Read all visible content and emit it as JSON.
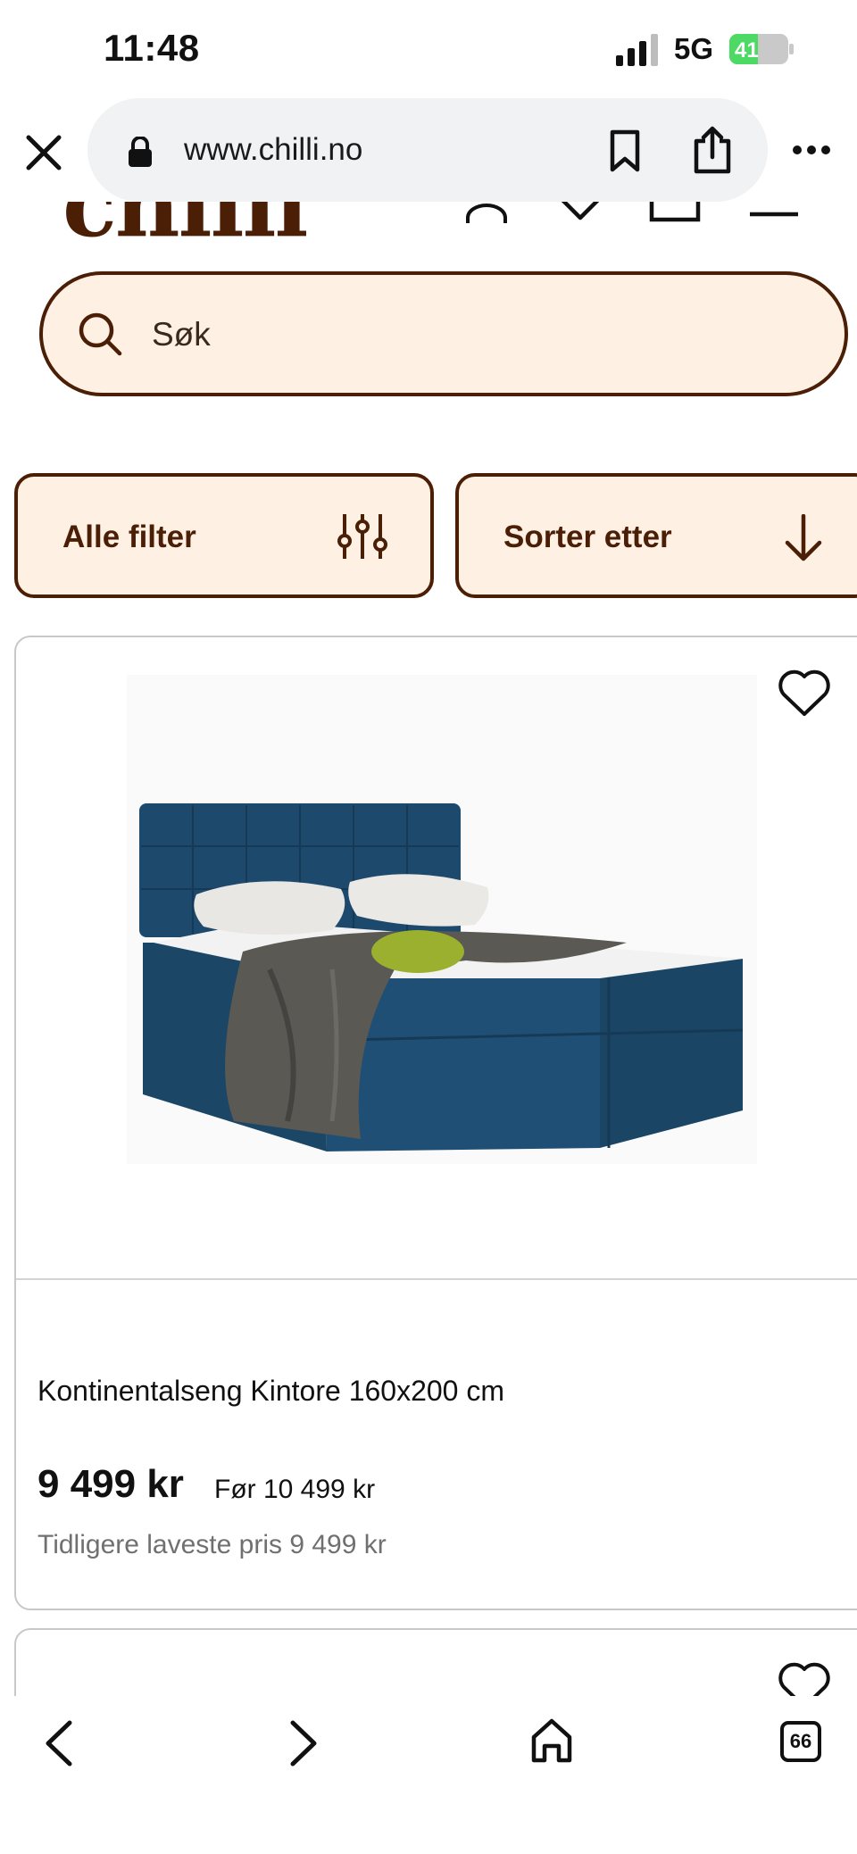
{
  "status_bar": {
    "time": "11:48",
    "network": "5G",
    "battery": "41"
  },
  "browser": {
    "url": "www.chilli.no",
    "tab_count": "66"
  },
  "site": {
    "logo": "chilli",
    "search_placeholder": "Søk",
    "filters": {
      "all_filters_label": "Alle filter",
      "sort_label": "Sorter etter"
    }
  },
  "product": {
    "title": "Kontinentalseng Kintore 160x200 cm",
    "price": "9 499 kr",
    "old_price": "Før 10 499 kr",
    "lowest_price": "Tidligere laveste pris 9 499 kr"
  },
  "colors": {
    "brand_brown": "#4b1e06",
    "brand_cream": "#fff0e4",
    "battery_green": "#4cd964",
    "bed_blue": "#1b4a6e"
  },
  "icons": [
    "close-icon",
    "lock-icon",
    "bookmark-icon",
    "share-icon",
    "more-icon",
    "account-icon",
    "heart-icon",
    "cart-icon",
    "menu-icon",
    "search-icon",
    "filter-sliders-icon",
    "arrow-down-icon",
    "back-icon",
    "forward-icon",
    "home-icon",
    "tabs-icon"
  ]
}
